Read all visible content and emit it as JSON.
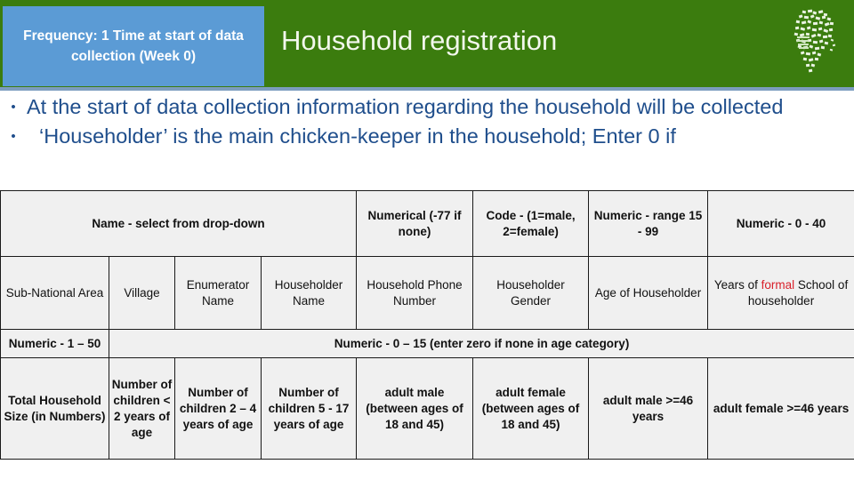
{
  "banner": {
    "title": "Household registration",
    "frequency_note": "Frequency: 1 Time at start of data collection (Week 0)",
    "green": "#3B7C0E",
    "blue_box": "#5B9BD5",
    "underline": "#7C9DBF",
    "logo_name": "africa-chickens-logo"
  },
  "body": {
    "bullets": [
      {
        "marker": "•",
        "text": "At the start of data collection information regarding the household will be collected"
      },
      {
        "marker": "•",
        "text": "‘Householder’   is the main chicken-keeper in the household; Enter 0 if"
      }
    ],
    "text_color": "#1F4E8C"
  },
  "table": {
    "row1": [
      {
        "label": "Name - select from drop-down",
        "colspan": 4
      },
      {
        "label": "Numerical (-77 if none)",
        "colspan": 1
      },
      {
        "label": "Code - (1=male, 2=female)",
        "colspan": 1
      },
      {
        "label": "Numeric - range 15 - 99",
        "colspan": 1
      },
      {
        "label": "Numeric - 0 - 40",
        "colspan": 1
      }
    ],
    "row2": [
      "Sub-National Area",
      "Village",
      "Enumerator Name",
      "Householder Name",
      "Household Phone Number",
      "Householder Gender",
      "Age of Householder"
    ],
    "row2_last": {
      "prefix": "Years of ",
      "highlight": "formal",
      "suffix": " School of householder"
    },
    "row3": [
      {
        "label": "Numeric - 1 – 50",
        "colspan": 1
      },
      {
        "label": "Numeric - 0 – 15 (enter zero if none in age category)",
        "colspan": 7
      }
    ],
    "row4": [
      "Total Household Size (in Numbers)",
      "Number of children < 2 years of age",
      "Number of children 2 – 4 years of age",
      "Number of children 5 - 17 years of age",
      "adult male (between ages of 18 and 45)",
      "adult female (between ages of 18 and 45)",
      "adult male >=46 years",
      "adult female >=46 years"
    ],
    "highlight_color": "#D8202A"
  }
}
